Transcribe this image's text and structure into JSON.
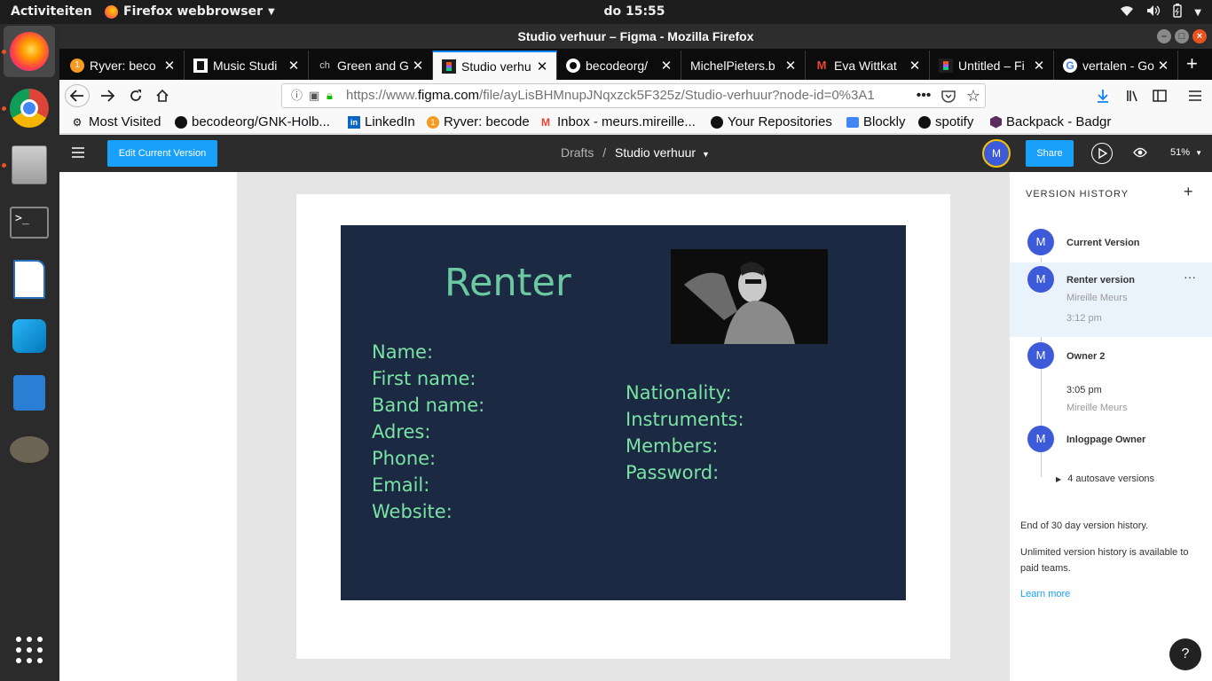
{
  "topbar": {
    "activities": "Activiteiten",
    "app_name": "Firefox webbrowser",
    "clock": "do 15:55"
  },
  "window": {
    "title": "Studio verhuur – Figma - Mozilla Firefox"
  },
  "tabs": [
    {
      "label": "Ryver: beco",
      "icon": "ryver-icon"
    },
    {
      "label": "Music Studi",
      "icon": "music-studio-icon"
    },
    {
      "label": "Green and G",
      "icon": "ch-icon"
    },
    {
      "label": "Studio verhu",
      "icon": "figma-icon",
      "selected": true
    },
    {
      "label": "becodeorg/",
      "icon": "github-icon"
    },
    {
      "label": "MichelPieters.b",
      "icon": "blank-icon"
    },
    {
      "label": "Eva Wittkat",
      "icon": "gmail-icon"
    },
    {
      "label": "Untitled – Fi",
      "icon": "figma-icon"
    },
    {
      "label": "vertalen - Go",
      "icon": "google-icon"
    }
  ],
  "url": {
    "prefix": "https://www.",
    "domain": "figma.com",
    "path": "/file/ayLisBHMnupJNqxzck5F325z/Studio-verhuur?node-id=0%3A1"
  },
  "bookmarks": [
    {
      "label": "Most Visited",
      "icon": "gear-icon"
    },
    {
      "label": "becodeorg/GNK-Holb...",
      "icon": "github-icon"
    },
    {
      "label": "LinkedIn",
      "icon": "linkedin-icon"
    },
    {
      "label": "Ryver: becode",
      "icon": "ryver-icon"
    },
    {
      "label": "Inbox - meurs.mireille...",
      "icon": "gmail-icon"
    },
    {
      "label": "Your Repositories",
      "icon": "github-icon"
    },
    {
      "label": "Blockly",
      "icon": "blockly-icon"
    },
    {
      "label": "spotify",
      "icon": "spotify-icon"
    },
    {
      "label": "Backpack - Badgr",
      "icon": "badgr-icon"
    }
  ],
  "figma": {
    "edit_button": "Edit Current Version",
    "breadcrumb_root": "Drafts",
    "breadcrumb_sep": "/",
    "file_name": "Studio verhuur",
    "avatar_letter": "M",
    "share_button": "Share",
    "zoom": "51%"
  },
  "card": {
    "title": "Renter",
    "left_fields": [
      "Name:",
      "First name:",
      "Band name:",
      "Adres:",
      "Phone:",
      "Email:",
      "Website:"
    ],
    "right_fields": [
      "Nationality:",
      "Instruments:",
      "Members:",
      "Password:"
    ]
  },
  "version_history": {
    "title": "VERSION HISTORY",
    "items": [
      {
        "avatar": "M",
        "name": "Current Version"
      },
      {
        "avatar": "M",
        "name": "Renter version",
        "author": "Mireille Meurs",
        "time": "3:12 pm"
      },
      {
        "avatar": "M",
        "name": "Owner 2",
        "time": "3:05 pm",
        "author": "Mireille Meurs"
      },
      {
        "avatar": "M",
        "name": "Inlogpage Owner"
      }
    ],
    "autosave": "4 autosave versions",
    "end_note": "End of 30 day version history.",
    "upgrade_note": "Unlimited version history is available to paid teams.",
    "learn_more": "Learn more"
  },
  "colors": {
    "figma_blue": "#18a0fb",
    "card_bg": "#1b2a42",
    "card_text": "#7ae3a4",
    "avatar": "#3d5bd9"
  }
}
